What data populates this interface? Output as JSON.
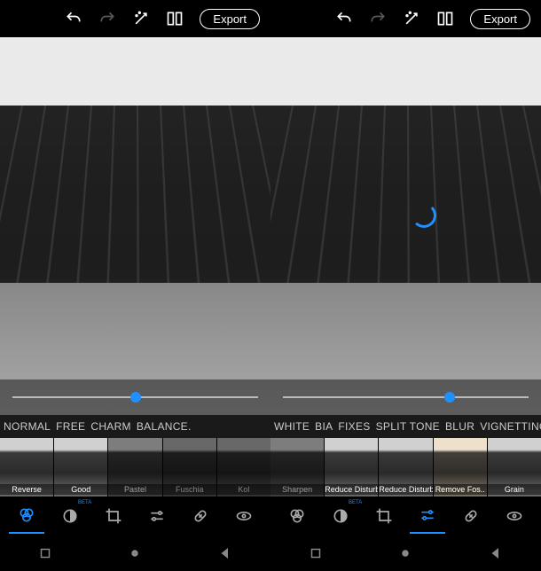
{
  "topbar": {
    "export_label": "Export"
  },
  "slider": {
    "left_pos_pct": 50,
    "right_pos_pct": 68
  },
  "categories_left": [
    "NORMAL",
    "FREE",
    "CHARM",
    "BALANCE."
  ],
  "categories_right": [
    "WHITE",
    "BIA",
    "FIXES",
    "SPLIT TONE",
    "BLUR",
    "VIGNETTING"
  ],
  "thumbs_left": [
    {
      "label": "Reverse",
      "cls": "t-pink"
    },
    {
      "label": "Good",
      "cls": ""
    },
    {
      "label": "Pastel",
      "cls": "t-blue"
    },
    {
      "label": "Fuschia",
      "cls": "t-purple"
    },
    {
      "label": "Kol",
      "cls": "t-green"
    }
  ],
  "thumbs_right": [
    {
      "label": "Sharpen",
      "cls": "t-teal"
    },
    {
      "label": "Reduce Disturb..",
      "cls": ""
    },
    {
      "label": "Reduce Disturb",
      "cls": ""
    },
    {
      "label": "Remove Fos..",
      "cls": "t-warm"
    },
    {
      "label": "Grain",
      "cls": ""
    }
  ],
  "tools": {
    "beta_label": "BETA"
  },
  "icons": {
    "undo": "undo-icon",
    "redo": "redo-icon",
    "wand": "wand-icon",
    "compare": "compare-icon"
  }
}
